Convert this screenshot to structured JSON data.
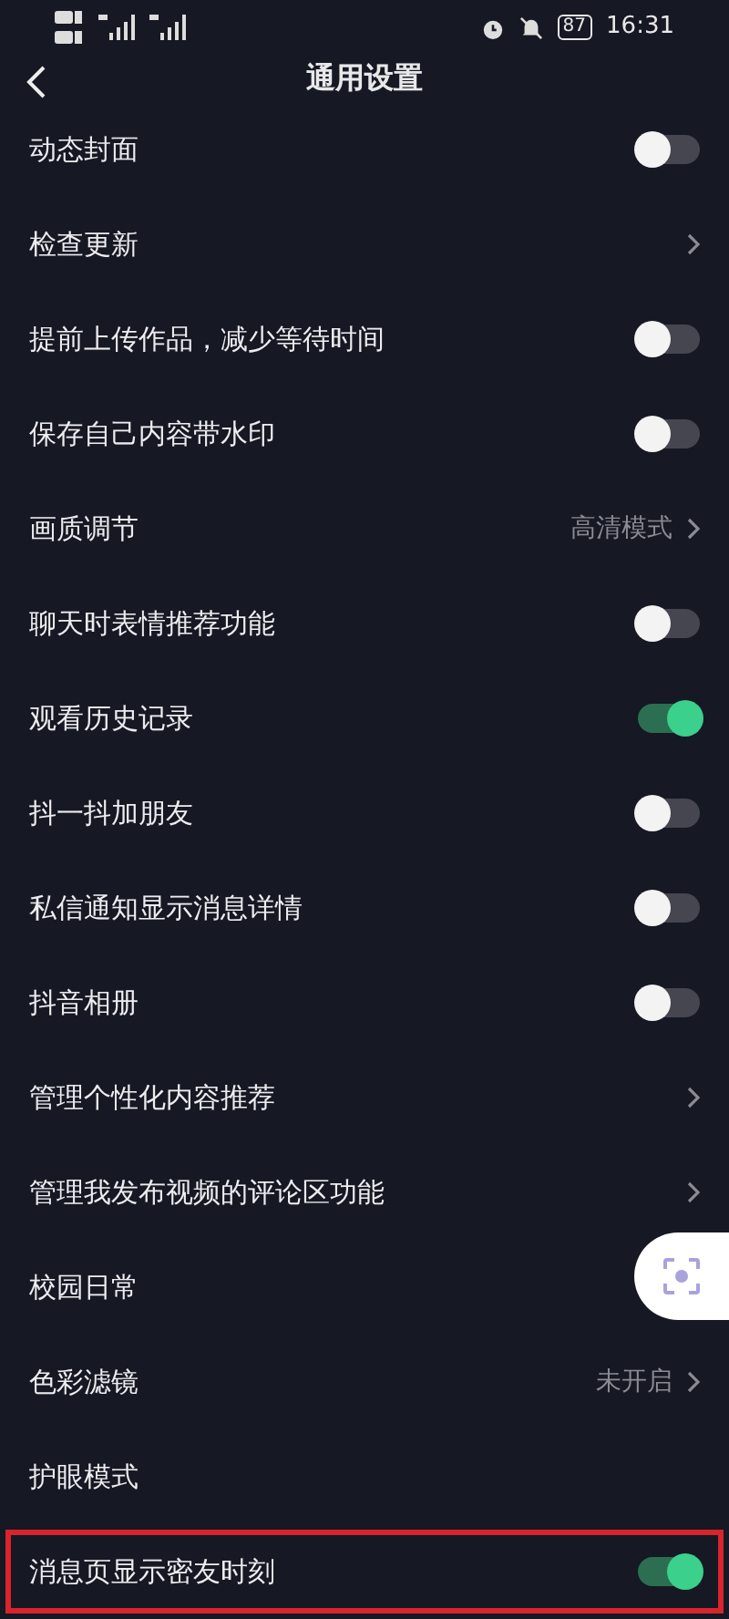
{
  "status_bar": {
    "battery": "87",
    "time": "16:31"
  },
  "header": {
    "title": "通用设置"
  },
  "rows": [
    {
      "label": "动态封面",
      "kind": "toggle",
      "on": false
    },
    {
      "label": "检查更新",
      "kind": "link"
    },
    {
      "label": "提前上传作品，减少等待时间",
      "kind": "toggle",
      "on": false
    },
    {
      "label": "保存自己内容带水印",
      "kind": "toggle",
      "on": false
    },
    {
      "label": "画质调节",
      "kind": "link",
      "value": "高清模式"
    },
    {
      "label": "聊天时表情推荐功能",
      "kind": "toggle",
      "on": false
    },
    {
      "label": "观看历史记录",
      "kind": "toggle",
      "on": true
    },
    {
      "label": "抖一抖加朋友",
      "kind": "toggle",
      "on": false
    },
    {
      "label": "私信通知显示消息详情",
      "kind": "toggle",
      "on": false
    },
    {
      "label": "抖音相册",
      "kind": "toggle",
      "on": false
    },
    {
      "label": "管理个性化内容推荐",
      "kind": "link"
    },
    {
      "label": "管理我发布视频的评论区功能",
      "kind": "link"
    },
    {
      "label": "校园日常",
      "kind": "plain"
    },
    {
      "label": "色彩滤镜",
      "kind": "link",
      "value": "未开启"
    },
    {
      "label": "护眼模式",
      "kind": "plain"
    },
    {
      "label": "消息页显示密友时刻",
      "kind": "toggle",
      "on": true,
      "highlighted": true
    }
  ]
}
